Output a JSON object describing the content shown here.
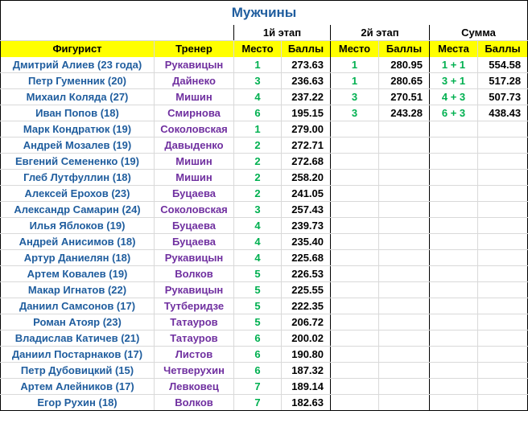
{
  "title": "Мужчины",
  "stage_headers": {
    "stage1": "1й этап",
    "stage2": "2й этап",
    "sum": "Сумма"
  },
  "columns": {
    "skater": "Фигурист",
    "coach": "Тренер",
    "place1": "Место",
    "score1": "Баллы",
    "place2": "Место",
    "score2": "Баллы",
    "places_sum": "Места",
    "score_sum": "Баллы"
  },
  "rows": [
    {
      "name": "Дмитрий Алиев (23 года)",
      "coach": "Рукавицын",
      "place1": "1",
      "score1": "273.63",
      "place2": "1",
      "score2": "280.95",
      "places": "1 + 1",
      "total": "554.58"
    },
    {
      "name": "Петр Гуменник (20)",
      "coach": "Дайнеко",
      "place1": "3",
      "score1": "236.63",
      "place2": "1",
      "score2": "280.65",
      "places": "3 + 1",
      "total": "517.28"
    },
    {
      "name": "Михаил Коляда (27)",
      "coach": "Мишин",
      "place1": "4",
      "score1": "237.22",
      "place2": "3",
      "score2": "270.51",
      "places": "4 + 3",
      "total": "507.73"
    },
    {
      "name": "Иван Попов (18)",
      "coach": "Смирнова",
      "place1": "6",
      "score1": "195.15",
      "place2": "3",
      "score2": "243.28",
      "places": "6 + 3",
      "total": "438.43"
    },
    {
      "name": "Марк Кондратюк (19)",
      "coach": "Соколовская",
      "place1": "1",
      "score1": "279.00",
      "place2": "",
      "score2": "",
      "places": "",
      "total": ""
    },
    {
      "name": "Андрей Мозалев (19)",
      "coach": "Давыденко",
      "place1": "2",
      "score1": "272.71",
      "place2": "",
      "score2": "",
      "places": "",
      "total": ""
    },
    {
      "name": "Евгений Семененко (19)",
      "coach": "Мишин",
      "place1": "2",
      "score1": "272.68",
      "place2": "",
      "score2": "",
      "places": "",
      "total": ""
    },
    {
      "name": "Глеб Лутфуллин (18)",
      "coach": "Мишин",
      "place1": "2",
      "score1": "258.20",
      "place2": "",
      "score2": "",
      "places": "",
      "total": ""
    },
    {
      "name": "Алексей Ерохов (23)",
      "coach": "Буцаева",
      "place1": "2",
      "score1": "241.05",
      "place2": "",
      "score2": "",
      "places": "",
      "total": ""
    },
    {
      "name": "Александр Самарин (24)",
      "coach": "Соколовская",
      "place1": "3",
      "score1": "257.43",
      "place2": "",
      "score2": "",
      "places": "",
      "total": ""
    },
    {
      "name": "Илья Яблоков (19)",
      "coach": "Буцаева",
      "place1": "4",
      "score1": "239.73",
      "place2": "",
      "score2": "",
      "places": "",
      "total": ""
    },
    {
      "name": "Андрей Анисимов (18)",
      "coach": "Буцаева",
      "place1": "4",
      "score1": "235.40",
      "place2": "",
      "score2": "",
      "places": "",
      "total": ""
    },
    {
      "name": "Артур Даниелян (18)",
      "coach": "Рукавицын",
      "place1": "4",
      "score1": "225.68",
      "place2": "",
      "score2": "",
      "places": "",
      "total": ""
    },
    {
      "name": "Артем Ковалев (19)",
      "coach": "Волков",
      "place1": "5",
      "score1": "226.53",
      "place2": "",
      "score2": "",
      "places": "",
      "total": ""
    },
    {
      "name": "Макар Игнатов (22)",
      "coach": "Рукавицын",
      "place1": "5",
      "score1": "225.55",
      "place2": "",
      "score2": "",
      "places": "",
      "total": ""
    },
    {
      "name": "Даниил Самсонов (17)",
      "coach": "Тутберидзе",
      "place1": "5",
      "score1": "222.35",
      "place2": "",
      "score2": "",
      "places": "",
      "total": ""
    },
    {
      "name": "Роман Атояр (23)",
      "coach": "Татауров",
      "place1": "5",
      "score1": "206.72",
      "place2": "",
      "score2": "",
      "places": "",
      "total": ""
    },
    {
      "name": "Владислав Катичев (21)",
      "coach": "Татауров",
      "place1": "6",
      "score1": "200.02",
      "place2": "",
      "score2": "",
      "places": "",
      "total": ""
    },
    {
      "name": "Даниил Постарнаков (17)",
      "coach": "Листов",
      "place1": "6",
      "score1": "190.80",
      "place2": "",
      "score2": "",
      "places": "",
      "total": ""
    },
    {
      "name": "Петр Дубовицкий (15)",
      "coach": "Четверухин",
      "place1": "6",
      "score1": "187.32",
      "place2": "",
      "score2": "",
      "places": "",
      "total": ""
    },
    {
      "name": "Артем Алейников (17)",
      "coach": "Левковец",
      "place1": "7",
      "score1": "189.14",
      "place2": "",
      "score2": "",
      "places": "",
      "total": ""
    },
    {
      "name": "Егор Рухин (18)",
      "coach": "Волков",
      "place1": "7",
      "score1": "182.63",
      "place2": "",
      "score2": "",
      "places": "",
      "total": ""
    }
  ]
}
